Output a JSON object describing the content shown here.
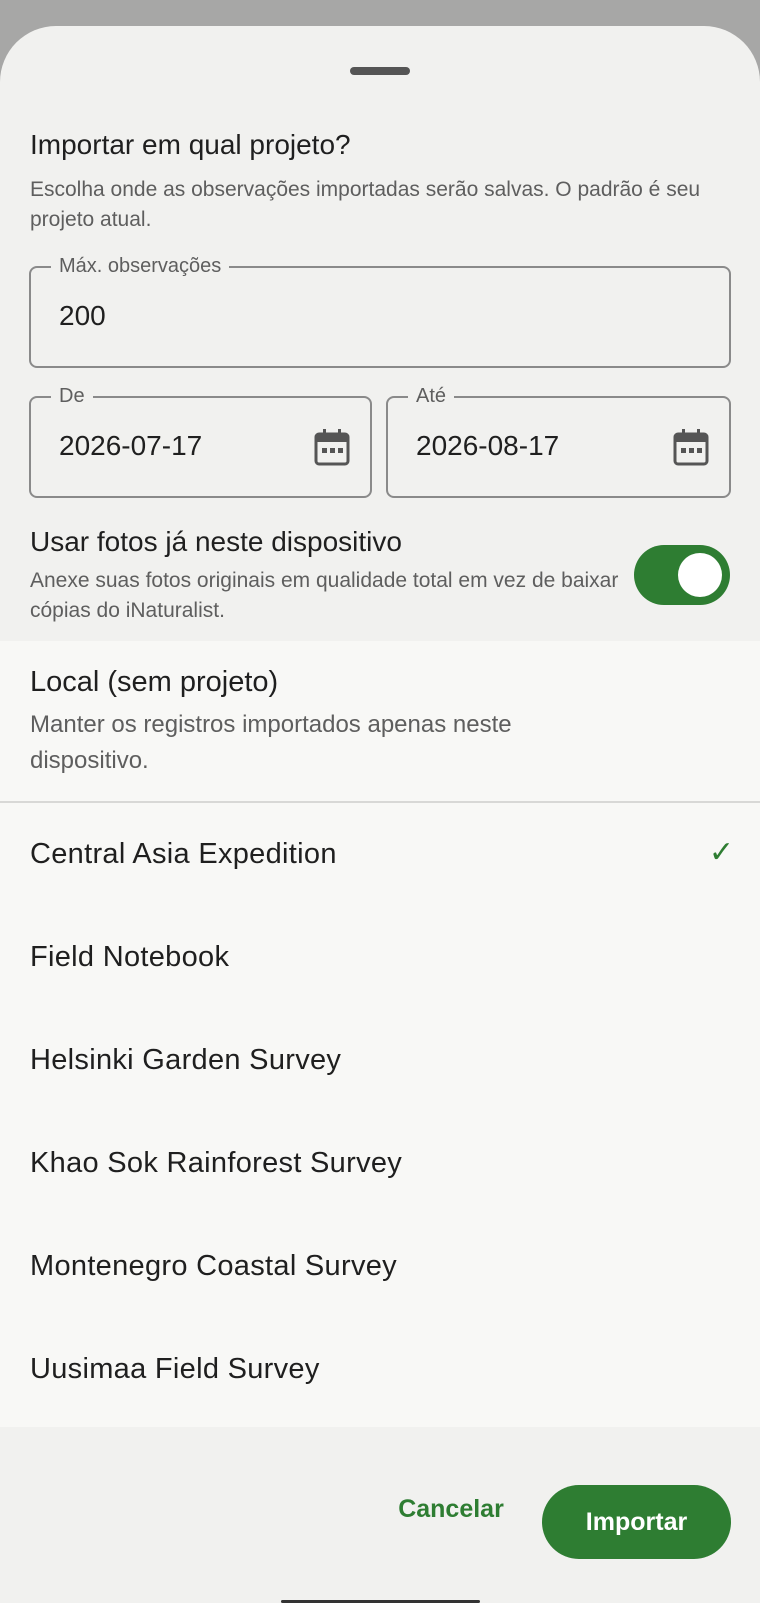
{
  "dialog": {
    "title": "Importar em qual projeto?",
    "subtitle": "Escolha onde as observações importadas serão salvas. O padrão é seu projeto atual."
  },
  "fields": {
    "max": {
      "label": "Máx. observações",
      "value": "200"
    },
    "from": {
      "label": "De",
      "value": "2026-07-17"
    },
    "to": {
      "label": "Até",
      "value": "2026-08-17"
    }
  },
  "device_photos": {
    "title": "Usar fotos já neste dispositivo",
    "description": "Anexe suas fotos originais em qualidade total em vez de baixar cópias do iNaturalist.",
    "enabled": true
  },
  "local": {
    "title": "Local (sem projeto)",
    "description": "Manter os registros importados apenas neste dispositivo."
  },
  "projects": [
    {
      "name": "Central Asia Expedition",
      "selected": true
    },
    {
      "name": "Field Notebook",
      "selected": false
    },
    {
      "name": "Helsinki Garden Survey",
      "selected": false
    },
    {
      "name": "Khao Sok Rainforest Survey",
      "selected": false
    },
    {
      "name": "Montenegro Coastal Survey",
      "selected": false
    },
    {
      "name": "Uusimaa Field Survey",
      "selected": false
    }
  ],
  "check_mark": "✓",
  "actions": {
    "cancel": "Cancelar",
    "import": "Importar"
  },
  "colors": {
    "accent": "#2e7d32",
    "sheet_bg": "#f1f1ef",
    "scrim": "#a7a7a6"
  }
}
